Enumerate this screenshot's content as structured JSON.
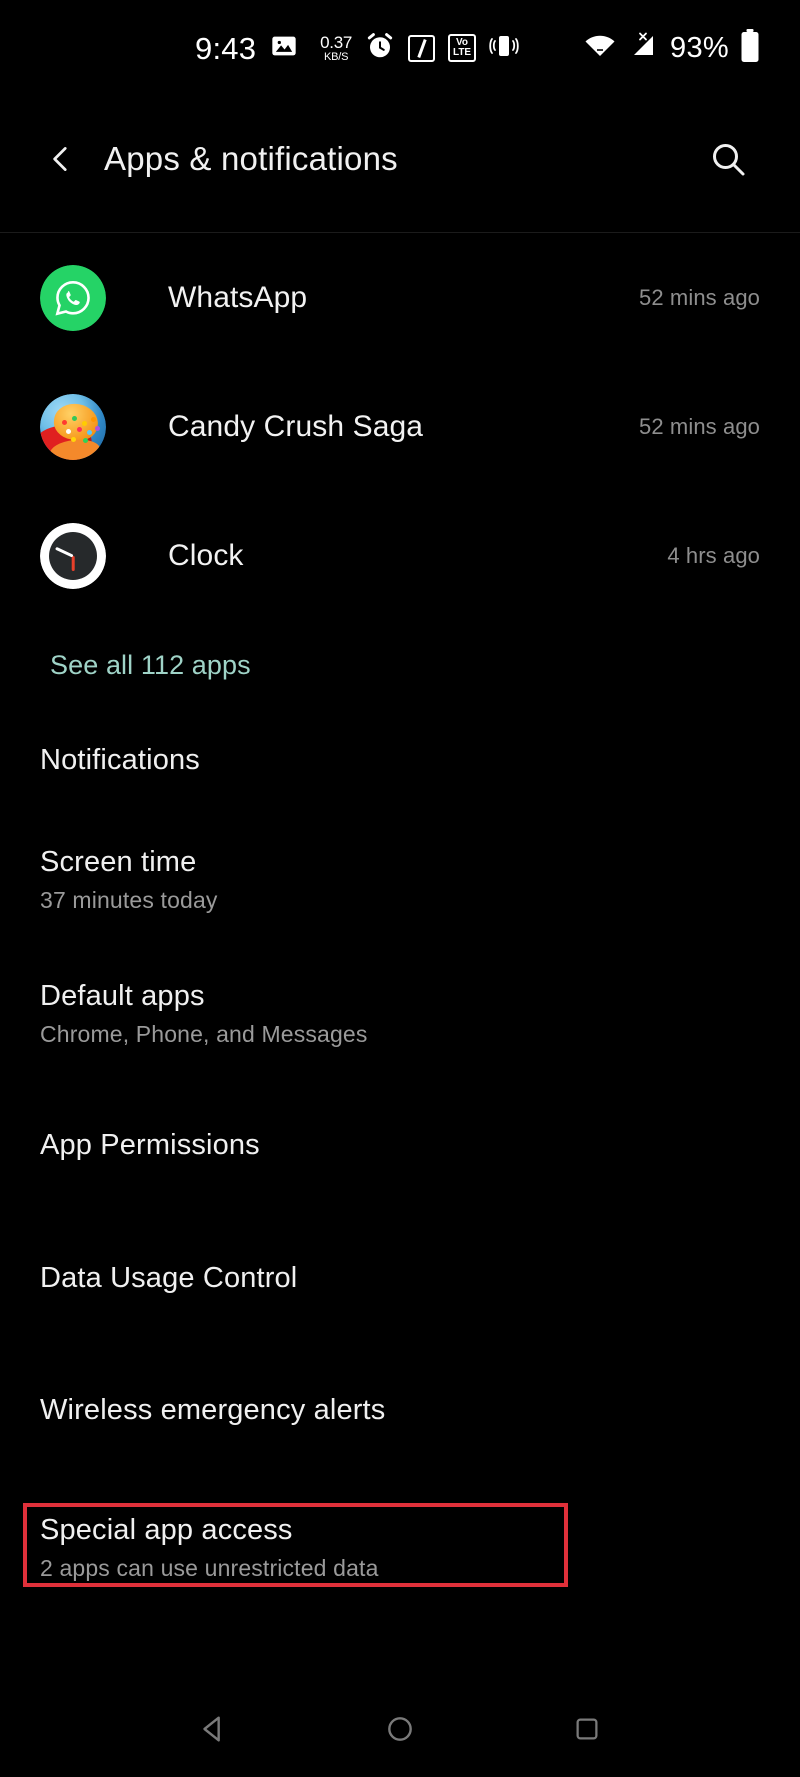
{
  "status_bar": {
    "time": "9:43",
    "network_speed_value": "0.37",
    "network_speed_unit": "KB/S",
    "volte_line1": "Vo",
    "volte_line2": "LTE",
    "battery_percent": "93%",
    "icons": [
      "screenshot-icon",
      "network-speed-icon",
      "alarm-icon",
      "nfc-icon",
      "volte-icon",
      "vibrate-icon",
      "wifi-icon",
      "mobile-signal-no-service-icon",
      "battery-icon"
    ]
  },
  "app_bar": {
    "back_label": "Back",
    "title": "Apps & notifications",
    "search_label": "Search"
  },
  "recent_apps": [
    {
      "name": "WhatsApp",
      "time": "52 mins ago",
      "icon": "whatsapp-icon"
    },
    {
      "name": "Candy Crush Saga",
      "time": "52 mins ago",
      "icon": "candy-crush-saga-icon"
    },
    {
      "name": "Clock",
      "time": "4 hrs ago",
      "icon": "clock-icon"
    }
  ],
  "see_all": {
    "label": "See all 112 apps",
    "color": "#9fd3c7"
  },
  "settings": [
    {
      "title": "Notifications",
      "subtitle": ""
    },
    {
      "title": "Screen time",
      "subtitle": "37 minutes today"
    },
    {
      "title": "Default apps",
      "subtitle": "Chrome, Phone, and Messages"
    },
    {
      "title": "App Permissions",
      "subtitle": ""
    },
    {
      "title": "Data Usage Control",
      "subtitle": ""
    },
    {
      "title": "Wireless emergency alerts",
      "subtitle": ""
    },
    {
      "title": "Special app access",
      "subtitle": "2 apps can use unrestricted data"
    }
  ],
  "highlight": {
    "target": "Special app access",
    "border_color": "#e0303a"
  },
  "nav_bar": {
    "back": "back-triangle-icon",
    "home": "home-circle-icon",
    "recents": "recents-square-icon"
  }
}
